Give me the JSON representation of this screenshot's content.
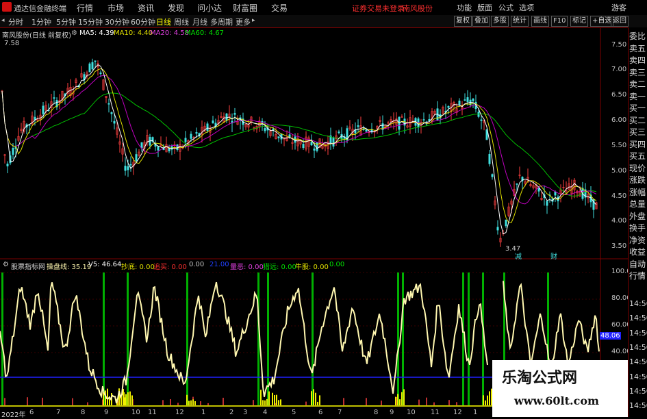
{
  "app": {
    "title": "通达信金融终端"
  },
  "menu": [
    "行情",
    "市场",
    "资讯",
    "发现",
    "问小达",
    "财富圈",
    "交易"
  ],
  "status": {
    "warn1": "证券交易未登录",
    "warn2": "南风股份"
  },
  "right_menu": [
    "功能",
    "版面",
    "公式",
    "选项",
    "游客"
  ],
  "periods": [
    "分时",
    "1分钟",
    "5分钟",
    "15分钟",
    "30分钟",
    "60分钟",
    "日线",
    "周线",
    "月线",
    "多周期",
    "更多"
  ],
  "active_period": "日线",
  "toolbar_right": [
    "复权",
    "叠加",
    "多股",
    "统计",
    "画线",
    "F10",
    "标记",
    "+自选",
    "返回"
  ],
  "main": {
    "stock_label": "南风股份(日线 前复权)",
    "ma5": "MA5: 4.39",
    "ma10": "MA10: 4.40",
    "ma20": "MA20: 4.58",
    "ma60": "MA60: 4.67",
    "high_mark": "7.58",
    "low_mark": "3.47",
    "mark1": "减",
    "mark2": "财",
    "y_labels": [
      "7.50",
      "7.00",
      "6.50",
      "6.00",
      "5.50",
      "5.00",
      "4.50",
      "4.00",
      "3.50"
    ]
  },
  "indicator": {
    "name": "股票指标网",
    "l1": "操盘线: 35.19",
    "l2": "V5: 46.64",
    "l3": "抄底: 0.00",
    "l4": "追买: 0.00",
    "l5": "0.00",
    "l6": "21.00",
    "l7": "量恶: 0.00",
    "l8": "猎远: 0.00",
    "l9": "牛股: 0.00",
    "l10": "0.00",
    "y_labels": [
      "100.00",
      "80.00",
      "60.00",
      "40.00"
    ],
    "current": "48.06"
  },
  "side_panel": [
    "委比",
    "卖五",
    "卖四",
    "卖三",
    "卖二",
    "卖一",
    "买一",
    "买二",
    "买三",
    "买四",
    "买五",
    "现价",
    "涨跌",
    "涨幅",
    "总量",
    "外盘",
    "换手",
    "净资",
    "收益",
    "自动",
    "行情"
  ],
  "side_times": [
    "14:50",
    "14:50",
    "14:50",
    "14:50",
    "14:50",
    "14:50",
    "14:50",
    "14:50"
  ],
  "x_labels": [
    "2022年",
    "6",
    "7",
    "8",
    "9",
    "10",
    "11",
    "12",
    "1",
    "2",
    "3",
    "4",
    "5",
    "6",
    "7",
    "8",
    "9",
    "10",
    "11",
    "12",
    "1"
  ],
  "watermark": {
    "line1": "乐淘公式网",
    "line2": "www.60lt.com"
  },
  "colors": {
    "ma5": "#ffffff",
    "ma10": "#ffff00",
    "ma20": "#ff00ff",
    "ma60": "#00ff00",
    "up": "#ff4040",
    "down": "#40e0e0",
    "warn": "#ff3030"
  }
}
